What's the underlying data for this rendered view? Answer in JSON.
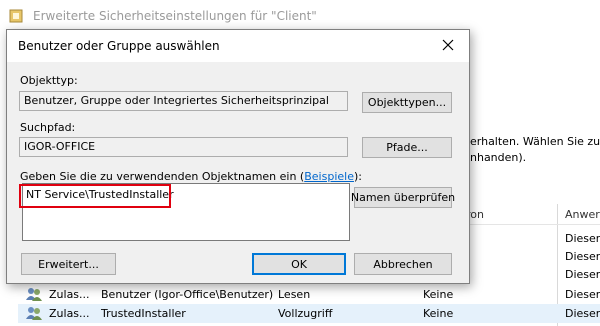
{
  "background_window": {
    "title": "Erweiterte Sicherheitseinstellungen für \"Client\"",
    "info_line1": "erhalten. Wählen Sie zum",
    "info_line2": "nhanden).",
    "column_zugriff": "ron",
    "column_anwenden": "Anwer",
    "rows": [
      {
        "type": "",
        "principal": "",
        "access": "",
        "applies": "Dieser"
      },
      {
        "type": "",
        "principal": "",
        "access": "",
        "applies": "Dieser"
      },
      {
        "type": "",
        "principal": "",
        "access": "",
        "applies": "Dieser"
      },
      {
        "type": "",
        "principal": "",
        "access": "",
        "applies": "Dieser"
      },
      {
        "type": "Zulas...",
        "principal": "Benutzer (Igor-Office\\Benutzer)",
        "access": "Lesen",
        "inherited": "Keine",
        "applies": "Dieser"
      },
      {
        "type": "Zulas...",
        "principal": "TrustedInstaller",
        "access": "Vollzugriff",
        "inherited": "Keine",
        "applies": "Dieser"
      }
    ]
  },
  "dialog": {
    "title": "Benutzer oder Gruppe auswählen",
    "objecttype_label": "Objekttyp:",
    "objecttype_value": "Benutzer, Gruppe oder Integriertes Sicherheitsprinzipal",
    "objecttypes_button": "Objekttypen...",
    "path_label": "Suchpfad:",
    "path_value": "IGOR-OFFICE",
    "paths_button": "Pfade...",
    "names_label_pre": "Geben Sie die zu verwendenden Objektnamen ein (",
    "names_label_link": "Beispiele",
    "names_label_post": "):",
    "names_value": "NT Service\\TrustedInstaller",
    "check_names_button": "Namen überprüfen",
    "advanced_button": "Erweitert...",
    "ok_button": "OK",
    "cancel_button": "Abbrechen"
  },
  "colors": {
    "highlight_box": "#e0000f",
    "link": "#0066cc",
    "dialog_bg": "#f0f0f0"
  }
}
